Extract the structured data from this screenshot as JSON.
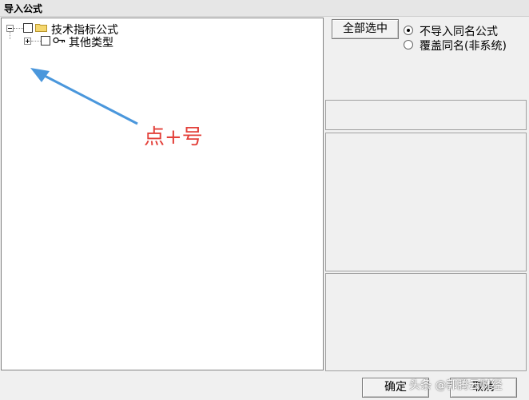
{
  "window": {
    "title": "导入公式"
  },
  "tree": {
    "root": {
      "label": "技术指标公式",
      "expanded": true,
      "checked": false
    },
    "children": [
      {
        "label": "其他类型",
        "expanded": false,
        "checked": false
      }
    ]
  },
  "annotation": {
    "text": "点+号",
    "color": "#e3403a"
  },
  "buttons": {
    "select_all": "全部选中",
    "ok": "确定",
    "cancel": "取消"
  },
  "options": [
    {
      "label": "不导入同名公式",
      "selected": true
    },
    {
      "label": "覆盖同名(非系统)",
      "selected": false
    }
  ],
  "watermark": {
    "text": "头条 @郭腾云财经"
  },
  "colors": {
    "arrow": "#4a97dc",
    "folder": "#f5d76e"
  }
}
